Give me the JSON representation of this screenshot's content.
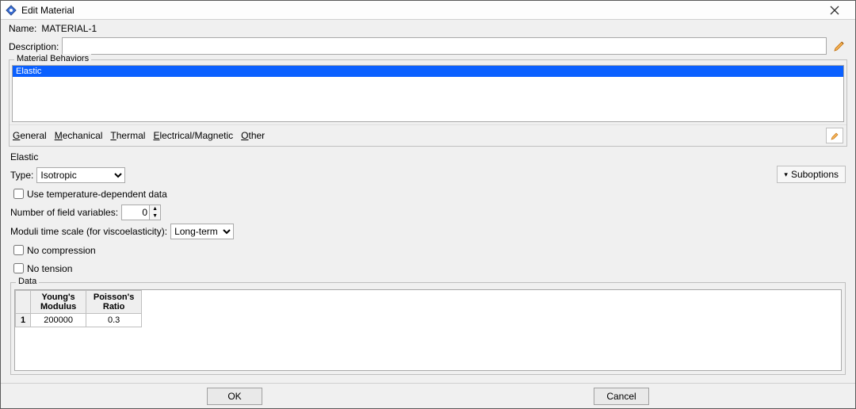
{
  "window": {
    "title": "Edit Material"
  },
  "name_label": "Name:",
  "name_value": "MATERIAL-1",
  "description_label": "Description:",
  "description_value": "",
  "behaviors_legend": "Material Behaviors",
  "behaviors": {
    "item0": "Elastic"
  },
  "menus": {
    "general": "General",
    "mechanical": "Mechanical",
    "thermal": "Thermal",
    "electrical": "Electrical/Magnetic",
    "other": "Other"
  },
  "section_title": "Elastic",
  "type_label": "Type:",
  "type_value": "Isotropic",
  "suboptions_label": "Suboptions",
  "temp_dep_label": "Use temperature-dependent data",
  "nfv_label": "Number of field variables:",
  "nfv_value": "0",
  "mts_label": "Moduli time scale (for viscoelasticity):",
  "mts_value": "Long-term",
  "no_compression_label": "No compression",
  "no_tension_label": "No tension",
  "data_legend": "Data",
  "table": {
    "headers": {
      "youngs": "Young's\nModulus",
      "poisson": "Poisson's\nRatio"
    },
    "row1": {
      "num": "1",
      "youngs": "200000",
      "poisson": "0.3"
    }
  },
  "buttons": {
    "ok": "OK",
    "cancel": "Cancel"
  }
}
